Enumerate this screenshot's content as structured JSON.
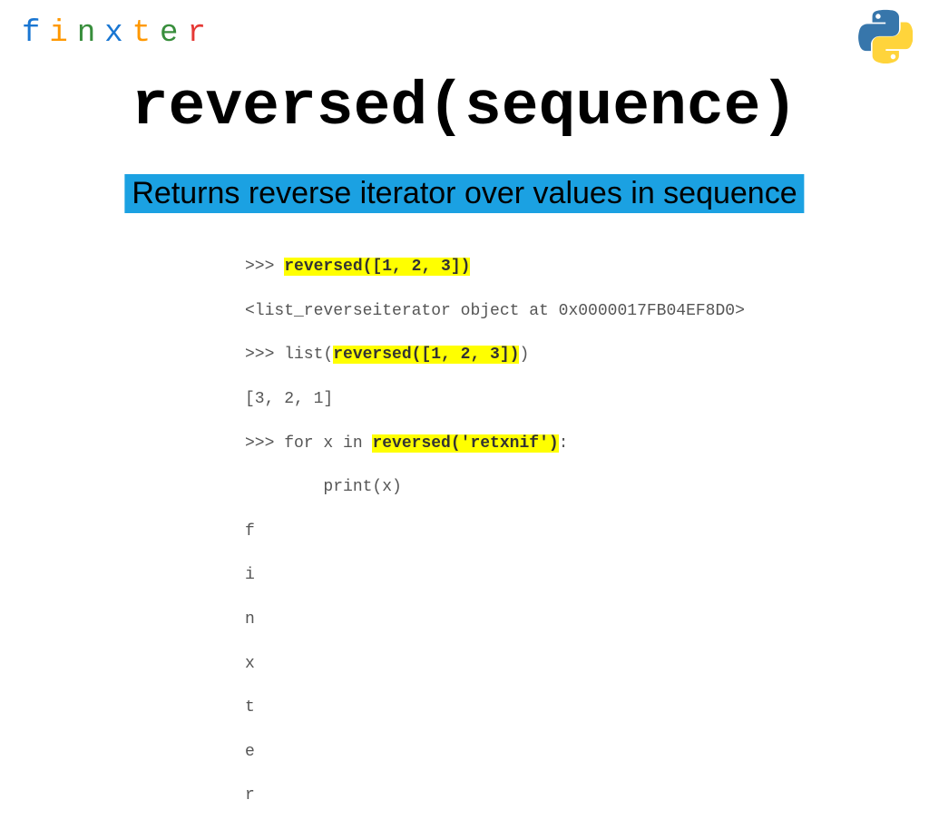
{
  "logo": {
    "letters": [
      "f",
      "i",
      "n",
      "x",
      "t",
      "e",
      "r"
    ],
    "colors": [
      "c-blue",
      "c-orange",
      "c-green",
      "c-blue",
      "c-orange",
      "c-green",
      "c-red"
    ]
  },
  "title": "reversed(sequence)",
  "subtitle": "Returns reverse iterator over values in sequence",
  "code": {
    "line1_prompt": ">>> ",
    "line1_hl": "reversed([1, 2, 3])",
    "line2": "<list_reverseiterator object at 0x0000017FB04EF8D0>",
    "line3_prompt": ">>> list(",
    "line3_hl": "reversed([1, 2, 3])",
    "line3_tail": ")",
    "line4": "[3, 2, 1]",
    "line5_prompt": ">>> for x in ",
    "line5_hl": "reversed('retxnif')",
    "line5_tail": ":",
    "line6": "        print(x)",
    "out1": "f",
    "out2": "i",
    "out3": "n",
    "out4": "x",
    "out5": "t",
    "out6": "e",
    "out7": "r"
  }
}
